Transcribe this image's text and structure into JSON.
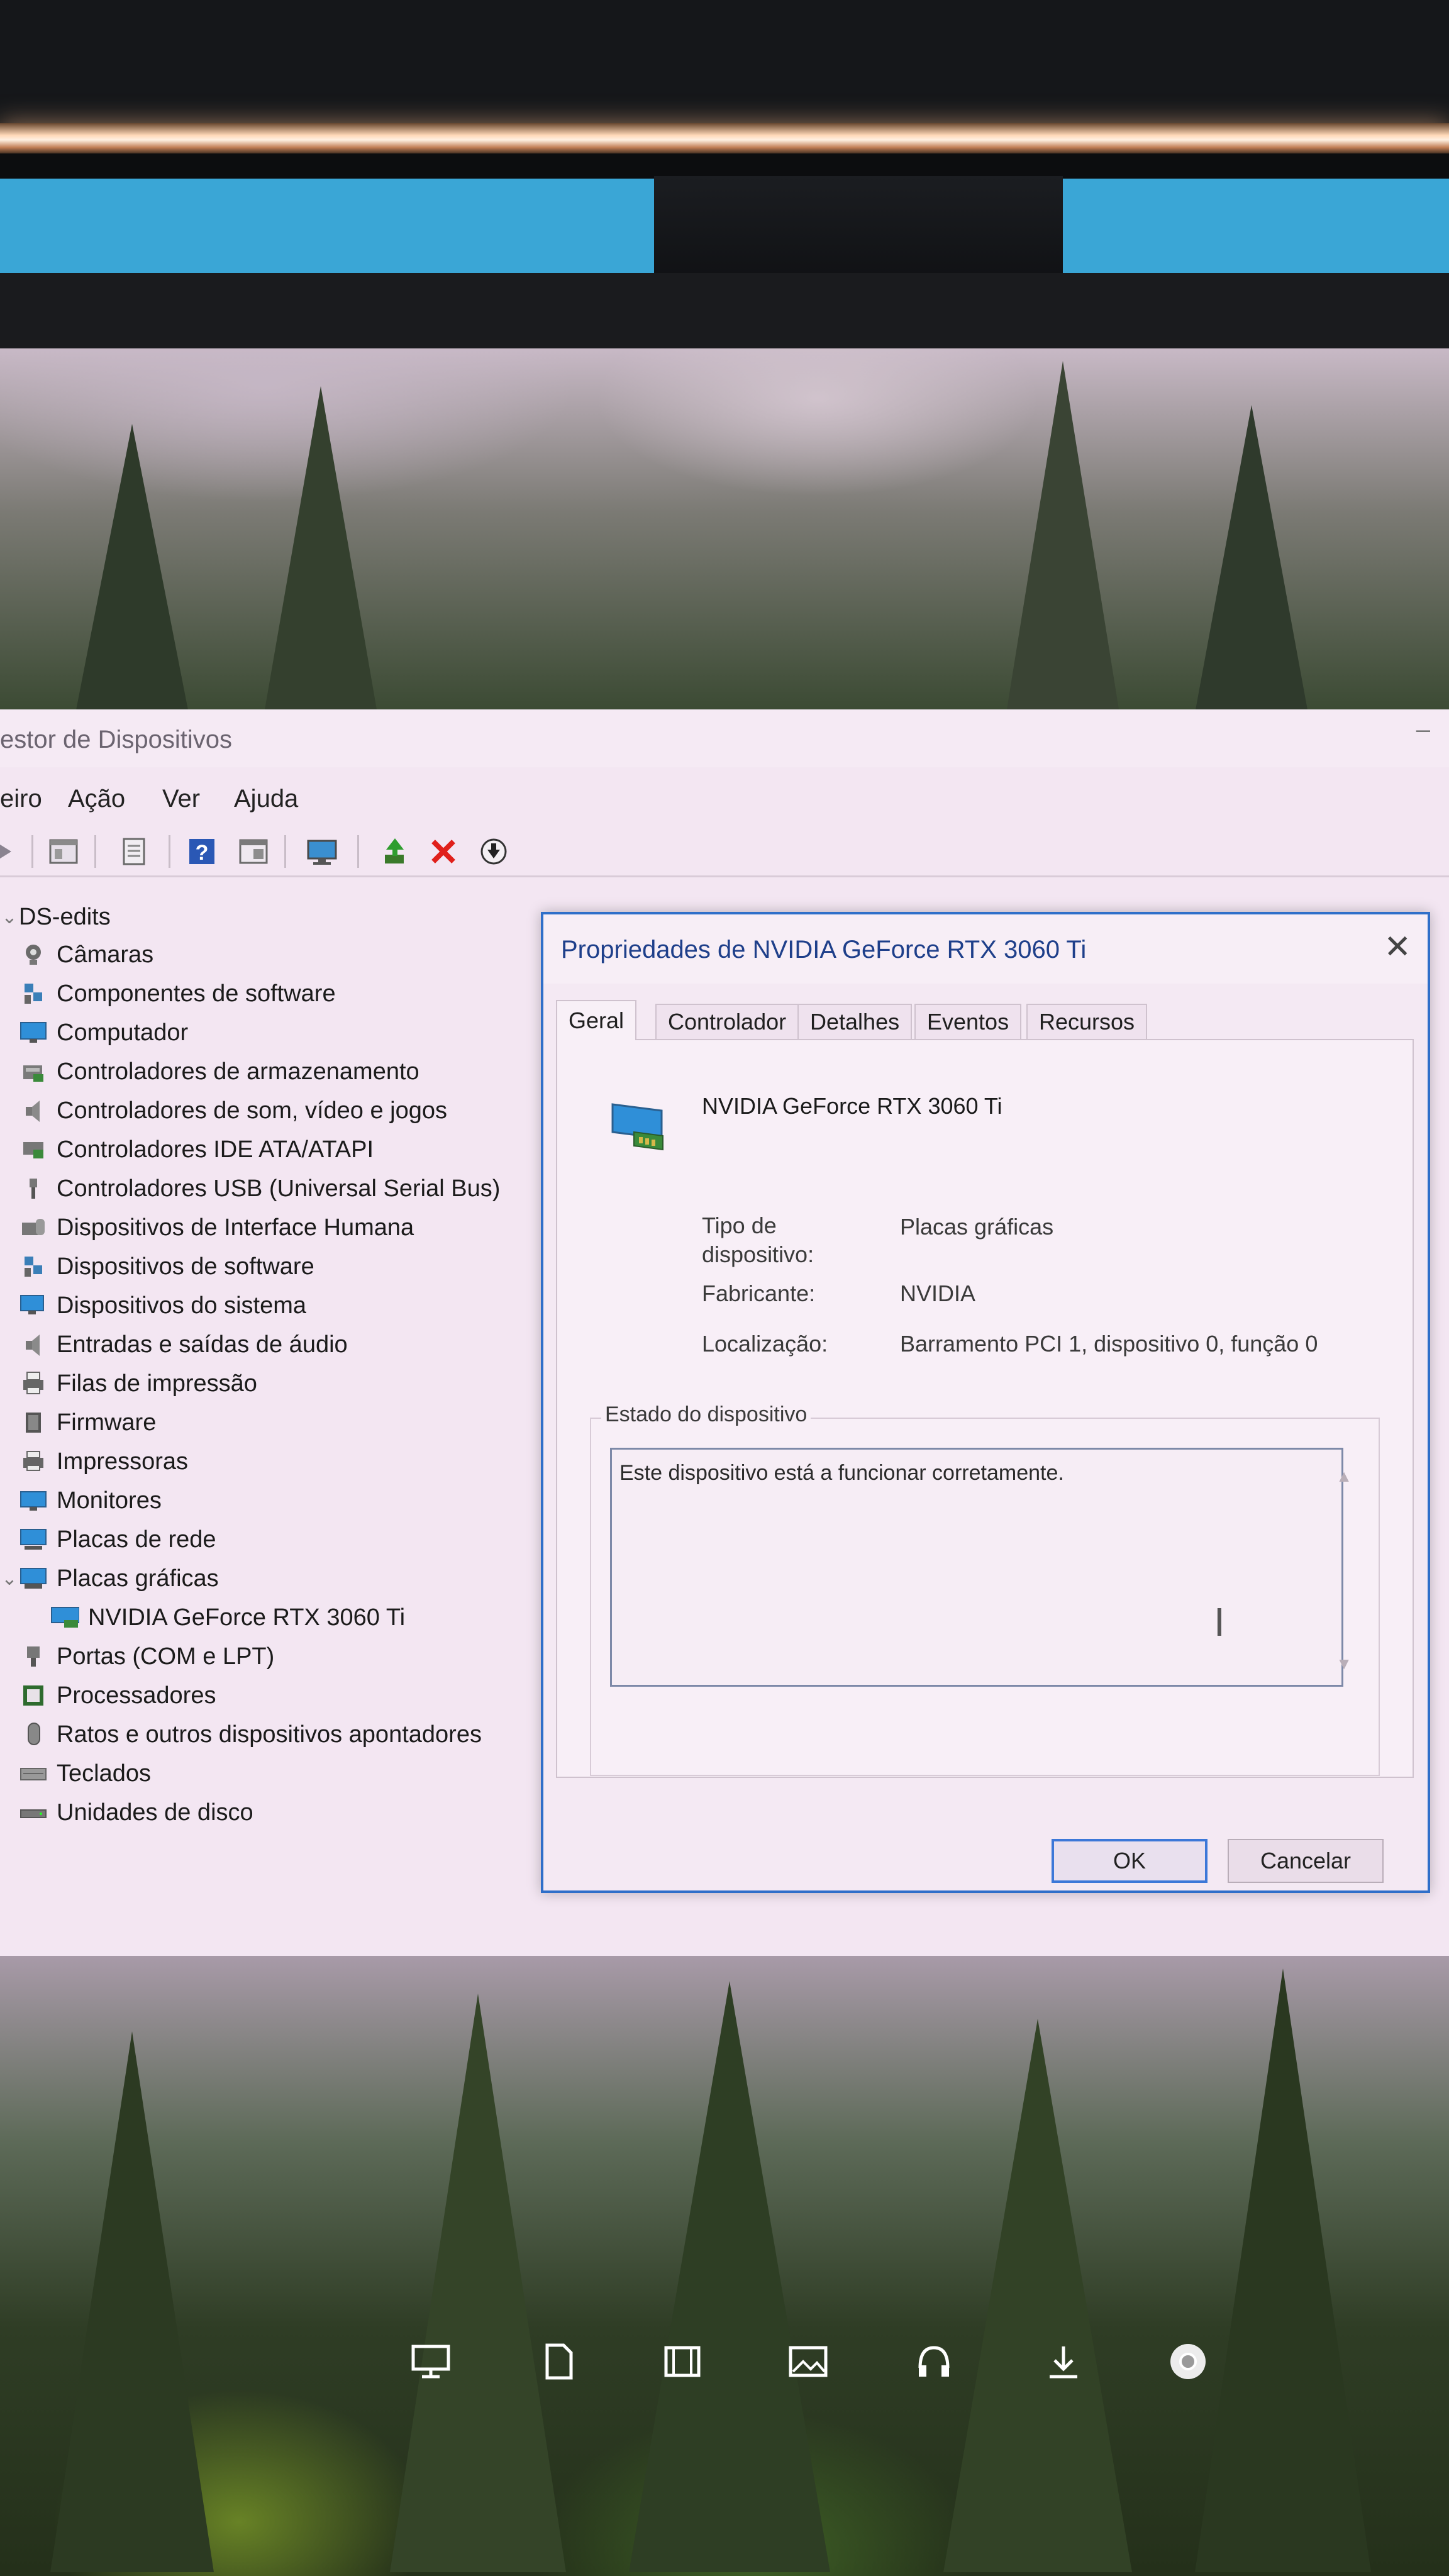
{
  "device_manager": {
    "title": "estor de Dispositivos",
    "menu": [
      "eiro",
      "Ação",
      "Ver",
      "Ajuda"
    ],
    "tree": {
      "root": "DS-edits",
      "categories": [
        {
          "label": "Câmaras",
          "icon": "camera-icon"
        },
        {
          "label": "Componentes de software",
          "icon": "software-component-icon"
        },
        {
          "label": "Computador",
          "icon": "computer-icon"
        },
        {
          "label": "Controladores de armazenamento",
          "icon": "storage-controller-icon"
        },
        {
          "label": "Controladores de som, vídeo e jogos",
          "icon": "speaker-icon"
        },
        {
          "label": "Controladores IDE ATA/ATAPI",
          "icon": "ide-controller-icon"
        },
        {
          "label": "Controladores USB (Universal Serial Bus)",
          "icon": "usb-icon"
        },
        {
          "label": "Dispositivos de Interface Humana",
          "icon": "hid-icon"
        },
        {
          "label": "Dispositivos de software",
          "icon": "software-device-icon"
        },
        {
          "label": "Dispositivos do sistema",
          "icon": "system-device-icon"
        },
        {
          "label": "Entradas e saídas de áudio",
          "icon": "audio-io-icon"
        },
        {
          "label": "Filas de impressão",
          "icon": "print-queue-icon"
        },
        {
          "label": "Firmware",
          "icon": "firmware-icon"
        },
        {
          "label": "Impressoras",
          "icon": "printer-icon"
        },
        {
          "label": "Monitores",
          "icon": "monitor-icon"
        },
        {
          "label": "Placas de rede",
          "icon": "network-adapter-icon"
        },
        {
          "label": "Placas gráficas",
          "icon": "display-adapter-icon",
          "expanded": true
        },
        {
          "label": "NVIDIA GeForce RTX 3060 Ti",
          "icon": "display-adapter-icon",
          "child": true
        },
        {
          "label": "Portas (COM e LPT)",
          "icon": "port-icon"
        },
        {
          "label": "Processadores",
          "icon": "processor-icon"
        },
        {
          "label": "Ratos e outros dispositivos apontadores",
          "icon": "mouse-icon"
        },
        {
          "label": "Teclados",
          "icon": "keyboard-icon"
        },
        {
          "label": "Unidades de disco",
          "icon": "disk-drive-icon"
        }
      ]
    }
  },
  "dialog": {
    "title": "Propriedades de NVIDIA GeForce RTX 3060 Ti",
    "tabs": [
      "Geral",
      "Controlador",
      "Detalhes",
      "Eventos",
      "Recursos"
    ],
    "active_tab": "Geral",
    "device_name": "NVIDIA GeForce RTX 3060 Ti",
    "properties": {
      "type_label": "Tipo de dispositivo:",
      "type_value": "Placas gráficas",
      "manufacturer_label": "Fabricante:",
      "manufacturer_value": "NVIDIA",
      "location_label": "Localização:",
      "location_value": "Barramento PCI 1, dispositivo 0, função 0"
    },
    "status_group_label": "Estado do dispositivo",
    "status_text": "Este dispositivo está a funcionar corretamente.",
    "ok_label": "OK",
    "cancel_label": "Cancelar"
  },
  "desktop_icons": [
    "monitor-icon",
    "document-icon",
    "film-icon",
    "picture-icon",
    "headphones-icon",
    "download-icon",
    "chrome-icon"
  ],
  "colors": {
    "accent": "#2f6fc9",
    "close_x_red": "#e0201b",
    "title_text": "#1e3f8a"
  }
}
